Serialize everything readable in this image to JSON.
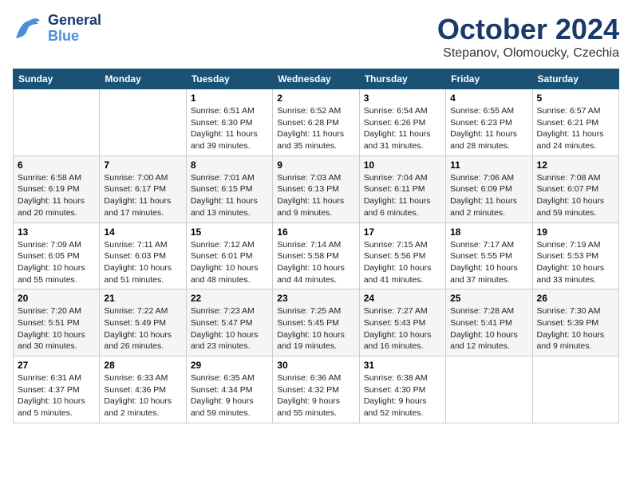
{
  "header": {
    "logo_line1": "General",
    "logo_line2": "Blue",
    "month_title": "October 2024",
    "subtitle": "Stepanov, Olomoucky, Czechia"
  },
  "weekdays": [
    "Sunday",
    "Monday",
    "Tuesday",
    "Wednesday",
    "Thursday",
    "Friday",
    "Saturday"
  ],
  "weeks": [
    [
      {
        "day": "",
        "sunrise": "",
        "sunset": "",
        "daylight": ""
      },
      {
        "day": "",
        "sunrise": "",
        "sunset": "",
        "daylight": ""
      },
      {
        "day": "1",
        "sunrise": "Sunrise: 6:51 AM",
        "sunset": "Sunset: 6:30 PM",
        "daylight": "Daylight: 11 hours and 39 minutes."
      },
      {
        "day": "2",
        "sunrise": "Sunrise: 6:52 AM",
        "sunset": "Sunset: 6:28 PM",
        "daylight": "Daylight: 11 hours and 35 minutes."
      },
      {
        "day": "3",
        "sunrise": "Sunrise: 6:54 AM",
        "sunset": "Sunset: 6:26 PM",
        "daylight": "Daylight: 11 hours and 31 minutes."
      },
      {
        "day": "4",
        "sunrise": "Sunrise: 6:55 AM",
        "sunset": "Sunset: 6:23 PM",
        "daylight": "Daylight: 11 hours and 28 minutes."
      },
      {
        "day": "5",
        "sunrise": "Sunrise: 6:57 AM",
        "sunset": "Sunset: 6:21 PM",
        "daylight": "Daylight: 11 hours and 24 minutes."
      }
    ],
    [
      {
        "day": "6",
        "sunrise": "Sunrise: 6:58 AM",
        "sunset": "Sunset: 6:19 PM",
        "daylight": "Daylight: 11 hours and 20 minutes."
      },
      {
        "day": "7",
        "sunrise": "Sunrise: 7:00 AM",
        "sunset": "Sunset: 6:17 PM",
        "daylight": "Daylight: 11 hours and 17 minutes."
      },
      {
        "day": "8",
        "sunrise": "Sunrise: 7:01 AM",
        "sunset": "Sunset: 6:15 PM",
        "daylight": "Daylight: 11 hours and 13 minutes."
      },
      {
        "day": "9",
        "sunrise": "Sunrise: 7:03 AM",
        "sunset": "Sunset: 6:13 PM",
        "daylight": "Daylight: 11 hours and 9 minutes."
      },
      {
        "day": "10",
        "sunrise": "Sunrise: 7:04 AM",
        "sunset": "Sunset: 6:11 PM",
        "daylight": "Daylight: 11 hours and 6 minutes."
      },
      {
        "day": "11",
        "sunrise": "Sunrise: 7:06 AM",
        "sunset": "Sunset: 6:09 PM",
        "daylight": "Daylight: 11 hours and 2 minutes."
      },
      {
        "day": "12",
        "sunrise": "Sunrise: 7:08 AM",
        "sunset": "Sunset: 6:07 PM",
        "daylight": "Daylight: 10 hours and 59 minutes."
      }
    ],
    [
      {
        "day": "13",
        "sunrise": "Sunrise: 7:09 AM",
        "sunset": "Sunset: 6:05 PM",
        "daylight": "Daylight: 10 hours and 55 minutes."
      },
      {
        "day": "14",
        "sunrise": "Sunrise: 7:11 AM",
        "sunset": "Sunset: 6:03 PM",
        "daylight": "Daylight: 10 hours and 51 minutes."
      },
      {
        "day": "15",
        "sunrise": "Sunrise: 7:12 AM",
        "sunset": "Sunset: 6:01 PM",
        "daylight": "Daylight: 10 hours and 48 minutes."
      },
      {
        "day": "16",
        "sunrise": "Sunrise: 7:14 AM",
        "sunset": "Sunset: 5:58 PM",
        "daylight": "Daylight: 10 hours and 44 minutes."
      },
      {
        "day": "17",
        "sunrise": "Sunrise: 7:15 AM",
        "sunset": "Sunset: 5:56 PM",
        "daylight": "Daylight: 10 hours and 41 minutes."
      },
      {
        "day": "18",
        "sunrise": "Sunrise: 7:17 AM",
        "sunset": "Sunset: 5:55 PM",
        "daylight": "Daylight: 10 hours and 37 minutes."
      },
      {
        "day": "19",
        "sunrise": "Sunrise: 7:19 AM",
        "sunset": "Sunset: 5:53 PM",
        "daylight": "Daylight: 10 hours and 33 minutes."
      }
    ],
    [
      {
        "day": "20",
        "sunrise": "Sunrise: 7:20 AM",
        "sunset": "Sunset: 5:51 PM",
        "daylight": "Daylight: 10 hours and 30 minutes."
      },
      {
        "day": "21",
        "sunrise": "Sunrise: 7:22 AM",
        "sunset": "Sunset: 5:49 PM",
        "daylight": "Daylight: 10 hours and 26 minutes."
      },
      {
        "day": "22",
        "sunrise": "Sunrise: 7:23 AM",
        "sunset": "Sunset: 5:47 PM",
        "daylight": "Daylight: 10 hours and 23 minutes."
      },
      {
        "day": "23",
        "sunrise": "Sunrise: 7:25 AM",
        "sunset": "Sunset: 5:45 PM",
        "daylight": "Daylight: 10 hours and 19 minutes."
      },
      {
        "day": "24",
        "sunrise": "Sunrise: 7:27 AM",
        "sunset": "Sunset: 5:43 PM",
        "daylight": "Daylight: 10 hours and 16 minutes."
      },
      {
        "day": "25",
        "sunrise": "Sunrise: 7:28 AM",
        "sunset": "Sunset: 5:41 PM",
        "daylight": "Daylight: 10 hours and 12 minutes."
      },
      {
        "day": "26",
        "sunrise": "Sunrise: 7:30 AM",
        "sunset": "Sunset: 5:39 PM",
        "daylight": "Daylight: 10 hours and 9 minutes."
      }
    ],
    [
      {
        "day": "27",
        "sunrise": "Sunrise: 6:31 AM",
        "sunset": "Sunset: 4:37 PM",
        "daylight": "Daylight: 10 hours and 5 minutes."
      },
      {
        "day": "28",
        "sunrise": "Sunrise: 6:33 AM",
        "sunset": "Sunset: 4:36 PM",
        "daylight": "Daylight: 10 hours and 2 minutes."
      },
      {
        "day": "29",
        "sunrise": "Sunrise: 6:35 AM",
        "sunset": "Sunset: 4:34 PM",
        "daylight": "Daylight: 9 hours and 59 minutes."
      },
      {
        "day": "30",
        "sunrise": "Sunrise: 6:36 AM",
        "sunset": "Sunset: 4:32 PM",
        "daylight": "Daylight: 9 hours and 55 minutes."
      },
      {
        "day": "31",
        "sunrise": "Sunrise: 6:38 AM",
        "sunset": "Sunset: 4:30 PM",
        "daylight": "Daylight: 9 hours and 52 minutes."
      },
      {
        "day": "",
        "sunrise": "",
        "sunset": "",
        "daylight": ""
      },
      {
        "day": "",
        "sunrise": "",
        "sunset": "",
        "daylight": ""
      }
    ]
  ]
}
